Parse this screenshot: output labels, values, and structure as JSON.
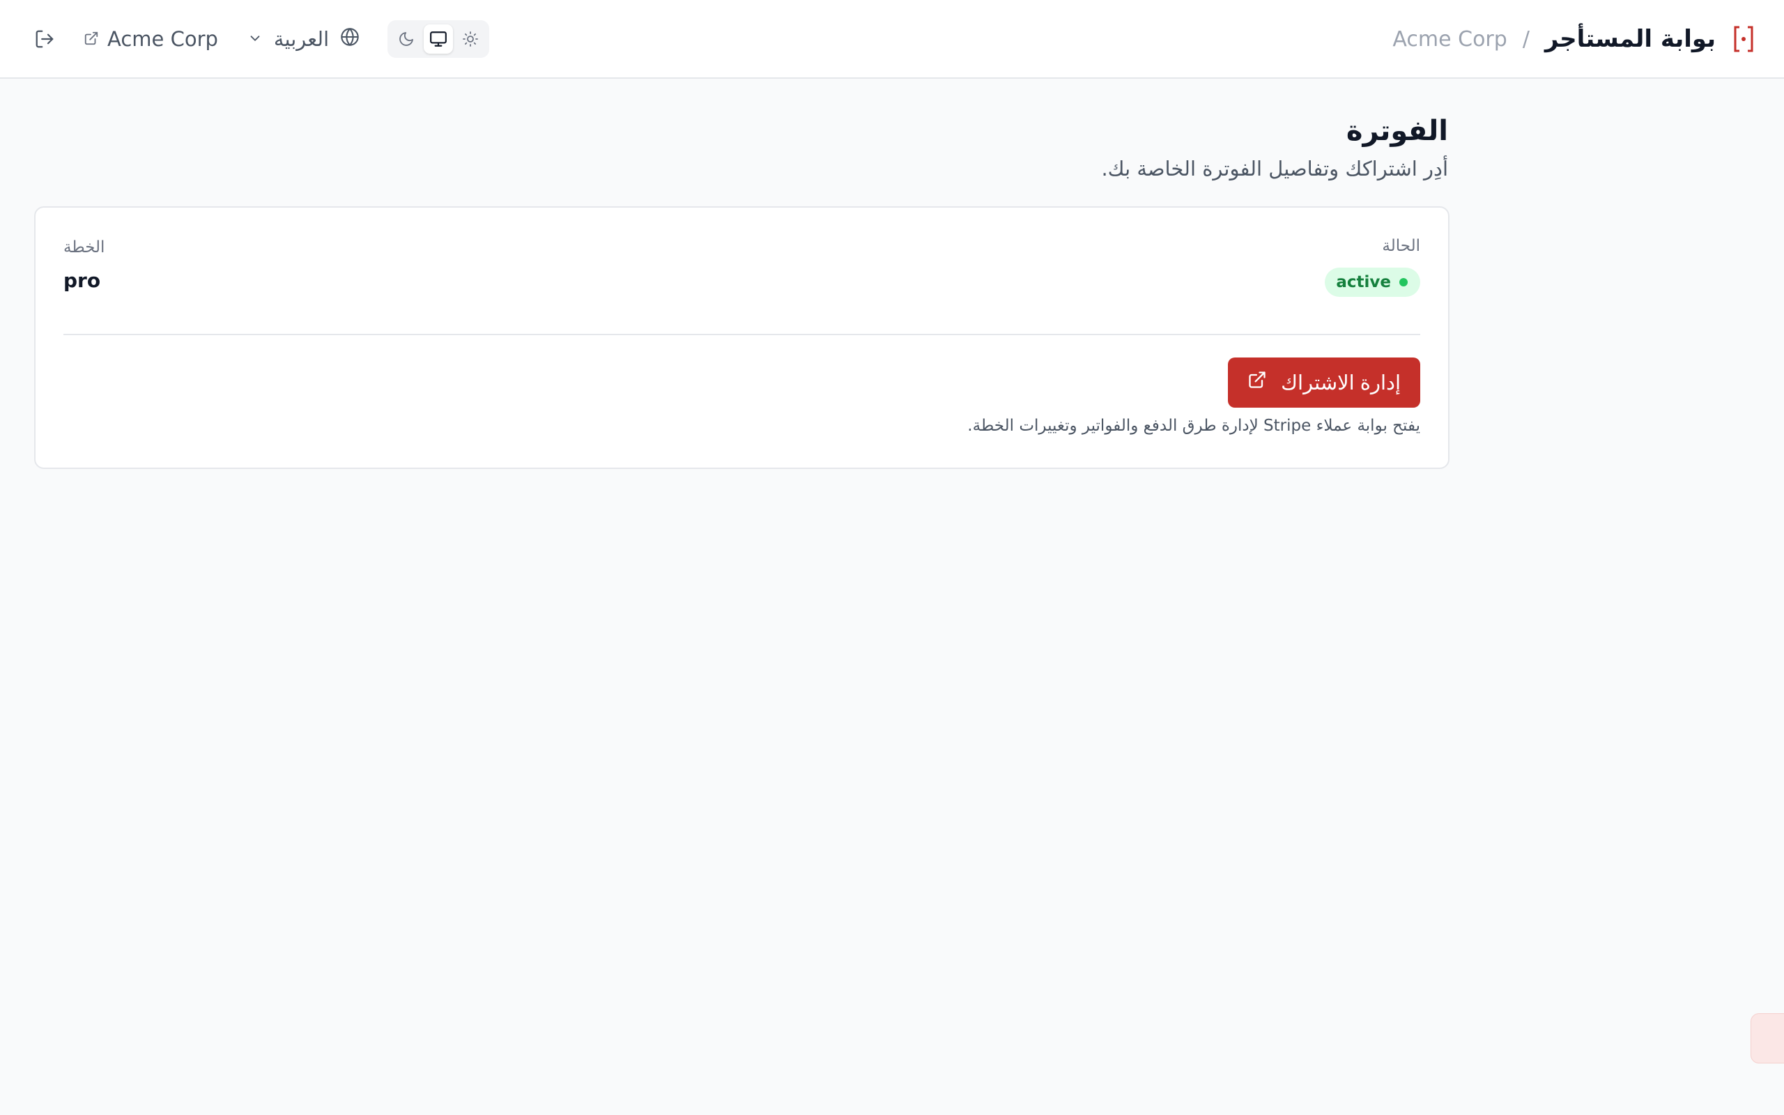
{
  "header": {
    "brand_title": "بوابة المستأجر",
    "separator": "/",
    "tenant_name": "Acme Corp",
    "tenant_link_label": "Acme Corp",
    "language_label": "العربية",
    "logo_icon": "bracket-dot-logo",
    "theme_options": [
      "dark-moon-icon",
      "system-monitor-icon",
      "light-sun-icon"
    ],
    "active_theme": "system"
  },
  "page": {
    "title": "الفوترة",
    "subtitle": "أدِر اشتراكك وتفاصيل الفوترة الخاصة بك."
  },
  "billing": {
    "status_label": "الحالة",
    "status_value": "active",
    "plan_label": "الخطة",
    "plan_value": "pro",
    "manage_button_label": "إدارة الاشتراك",
    "manage_note": "يفتح بوابة عملاء Stripe لإدارة طرق الدفع والفواتير وتغييرات الخطة."
  },
  "colors": {
    "accent": "#c5302a",
    "status_active_bg": "#dcfce7",
    "status_active_text": "#15803d",
    "status_dot": "#22c55e"
  }
}
